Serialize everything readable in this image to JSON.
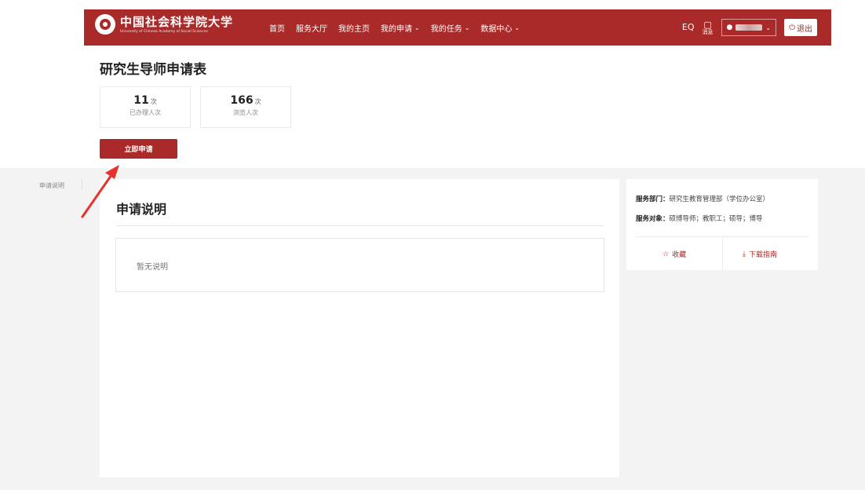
{
  "header": {
    "logo_cn": "中国社会科学院大学",
    "logo_en": "University of Chinese Academy of Social Sciences",
    "nav": [
      {
        "label": "首页",
        "dropdown": false
      },
      {
        "label": "服务大厅",
        "dropdown": false
      },
      {
        "label": "我的主页",
        "dropdown": false
      },
      {
        "label": "我的申请",
        "dropdown": true
      },
      {
        "label": "我的任务",
        "dropdown": true
      },
      {
        "label": "数据中心",
        "dropdown": true
      }
    ],
    "eq_label": "EQ",
    "message_label": "消息",
    "logout_label": "退出",
    "brand_color": "#a92a28"
  },
  "page": {
    "title": "研究生导师申请表",
    "stats": [
      {
        "value": "11",
        "unit": "次",
        "label": "已办理人次"
      },
      {
        "value": "166",
        "unit": "次",
        "label": "浏览人次"
      }
    ],
    "apply_button": "立即申请"
  },
  "sidebar": {
    "label": "申请说明"
  },
  "main": {
    "heading": "申请说明",
    "description": "暂无说明"
  },
  "info": {
    "dept_key": "服务部门：",
    "dept_value": "研究生教育管理部（学位办公室）",
    "target_key": "服务对象：",
    "target_value": "硕博导师；教职工；硕导；博导",
    "favorite_label": "收藏",
    "download_label": "下载指南"
  },
  "icons": {
    "favorite": "star-outline-icon",
    "download": "download-icon",
    "user": "user-icon",
    "logout": "power-icon",
    "message": "message-icon"
  }
}
